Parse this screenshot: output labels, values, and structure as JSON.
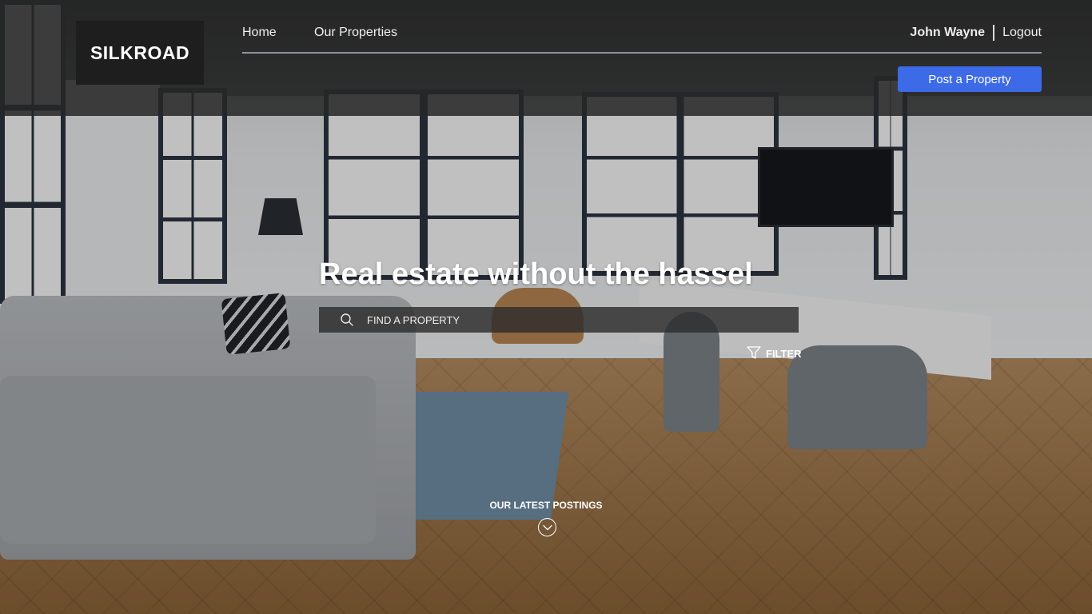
{
  "brand": {
    "name": "SILKROAD"
  },
  "nav": {
    "home": "Home",
    "properties": "Our Properties"
  },
  "user": {
    "name": "John Wayne",
    "logout": "Logout"
  },
  "actions": {
    "post_property": "Post a Property"
  },
  "hero": {
    "title": "Real estate without the hassel",
    "search_placeholder": "FIND A PROPERTY",
    "filter_label": "FILTER",
    "latest_label": "OUR LATEST POSTINGS"
  },
  "colors": {
    "accent": "#3d6ae6",
    "header_bg": "#262626",
    "logo_bg": "#1e1e1e"
  },
  "icons": {
    "search": "search-icon",
    "filter": "filter-icon",
    "scroll_down": "chevron-down-icon"
  }
}
